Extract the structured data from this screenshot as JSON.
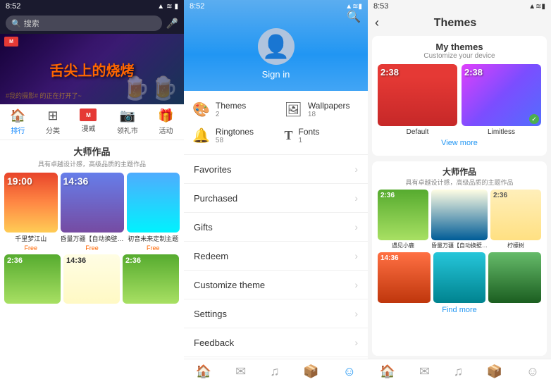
{
  "panel1": {
    "statusbar": {
      "time": "8:52",
      "icons": "📶🔋"
    },
    "search": {
      "placeholder": "搜索"
    },
    "banner": {
      "title": "舌尖上的烧烤",
      "subtitle": "#我的摄影# 的正在打开了~"
    },
    "nav": [
      {
        "id": "ranking",
        "label": "排行",
        "icon": "🏠",
        "active": false
      },
      {
        "id": "category",
        "label": "分类",
        "icon": "⊞",
        "active": false
      },
      {
        "id": "marvel",
        "label": "漫威",
        "icon": "M",
        "active": false
      },
      {
        "id": "store",
        "label": "领礼市",
        "icon": "📷",
        "active": false
      },
      {
        "id": "activity",
        "label": "活动",
        "icon": "🎁",
        "active": false
      }
    ],
    "section": {
      "title": "大师作品",
      "subtitle": "具有卓越设计感，高级品质的主题作品"
    },
    "themes": [
      {
        "name": "千里梦江山",
        "price": "Free",
        "time": "19:00"
      },
      {
        "name": "昏量万疆【自动换壁…",
        "price": "Free",
        "time": "14:36"
      },
      {
        "name": "初音未来定制主题",
        "price": "Free",
        "time": ""
      }
    ],
    "themes2": [
      {
        "name": "",
        "time": "2:36"
      },
      {
        "name": "",
        "time": "14:36"
      },
      {
        "name": "",
        "time": "2:36"
      }
    ]
  },
  "panel2": {
    "statusbar": {
      "time": "8:52",
      "icons": "📶🔋"
    },
    "user": {
      "signin_label": "Sign in"
    },
    "grid": [
      {
        "id": "themes",
        "label": "Themes",
        "count": "2",
        "icon": "🎨"
      },
      {
        "id": "wallpapers",
        "label": "Wallpapers",
        "count": "18",
        "icon": "🖼"
      },
      {
        "id": "ringtones",
        "label": "Ringtones",
        "count": "58",
        "icon": "🔔"
      },
      {
        "id": "fonts",
        "label": "Fonts",
        "count": "1",
        "icon": "T"
      }
    ],
    "menu": [
      {
        "id": "favorites",
        "label": "Favorites"
      },
      {
        "id": "purchased",
        "label": "Purchased"
      },
      {
        "id": "gifts",
        "label": "Gifts"
      },
      {
        "id": "redeem",
        "label": "Redeem"
      },
      {
        "id": "customize",
        "label": "Customize theme"
      },
      {
        "id": "settings",
        "label": "Settings"
      },
      {
        "id": "feedback",
        "label": "Feedback"
      }
    ],
    "bottomnav": [
      {
        "id": "home",
        "icon": "🏠",
        "active": false
      },
      {
        "id": "mail",
        "icon": "✉",
        "active": false
      },
      {
        "id": "music",
        "icon": "♫",
        "active": false
      },
      {
        "id": "store",
        "icon": "📦",
        "active": false
      },
      {
        "id": "profile",
        "icon": "☺",
        "active": true
      }
    ]
  },
  "panel3": {
    "statusbar": {
      "time": "8:53",
      "icons": "📶🔋"
    },
    "title": "Themes",
    "back_label": "‹",
    "mythemes": {
      "title": "My themes",
      "subtitle": "Customize your device",
      "themes": [
        {
          "name": "Default",
          "time": "2:38",
          "checked": false
        },
        {
          "name": "Limitless",
          "time": "2:38",
          "checked": true
        }
      ],
      "view_more": "View more"
    },
    "master": {
      "title": "大师作品",
      "subtitle": "具有卓越设计感，高级品质的主题作品",
      "themes": [
        {
          "name": "遇见小鹿",
          "time": "2:36"
        },
        {
          "name": "昏量万疆【自动换壁…",
          "time": ""
        },
        {
          "name": "柠檬树",
          "time": "2:36"
        }
      ],
      "themes2": [
        {
          "name": "",
          "time": "14:36"
        },
        {
          "name": "",
          "time": ""
        },
        {
          "name": "",
          "time": ""
        }
      ],
      "find_more": "Find more"
    },
    "bottomnav": [
      {
        "id": "home",
        "icon": "🏠"
      },
      {
        "id": "mail",
        "icon": "✉"
      },
      {
        "id": "music",
        "icon": "♫"
      },
      {
        "id": "store",
        "icon": "📦"
      },
      {
        "id": "profile",
        "icon": "☺"
      }
    ]
  }
}
